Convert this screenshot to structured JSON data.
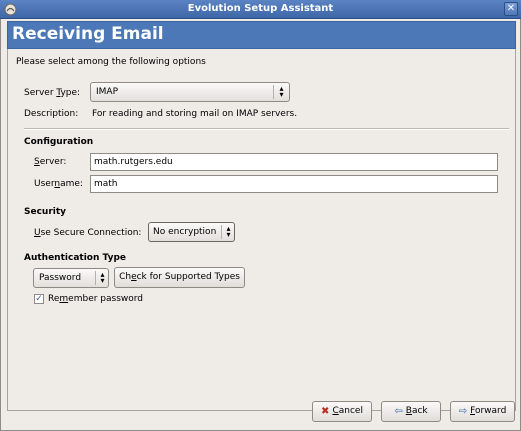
{
  "window": {
    "title": "Evolution Setup Assistant",
    "close_glyph": "✕",
    "app_icon": "evolution-icon"
  },
  "page": {
    "title": "Receiving Email",
    "intro": "Please select among the following options"
  },
  "server_type": {
    "label_pre": "Server ",
    "label_mn": "T",
    "label_post": "ype:",
    "value": "IMAP",
    "description_label": "Description:",
    "description": "For reading and storing mail on IMAP servers."
  },
  "configuration": {
    "heading": "Configuration",
    "server_label_mn": "S",
    "server_label_post": "erver:",
    "server_value": "math.rutgers.edu",
    "username_label_pre": "User",
    "username_label_mn": "n",
    "username_label_post": "ame:",
    "username_value": "math"
  },
  "security": {
    "heading": "Security",
    "label_mn": "U",
    "label_post": "se Secure Connection:",
    "value": "No encryption"
  },
  "authentication": {
    "heading": "Authentication Type",
    "type_value": "Password",
    "check_pre": "Ch",
    "check_mn": "e",
    "check_post": "ck for Supported Types",
    "remember_pre": "Re",
    "remember_mn": "m",
    "remember_post": "ember password",
    "remember_checked": true
  },
  "buttons": {
    "cancel_mn": "C",
    "cancel_post": "ancel",
    "back_mn": "B",
    "back_post": "ack",
    "forward_mn": "F",
    "forward_post": "orward"
  },
  "colors": {
    "header": "#4d78b8",
    "titlebar": "#4f76b6",
    "cancel_icon": "#c0281e",
    "nav_icon": "#3a63a3"
  }
}
